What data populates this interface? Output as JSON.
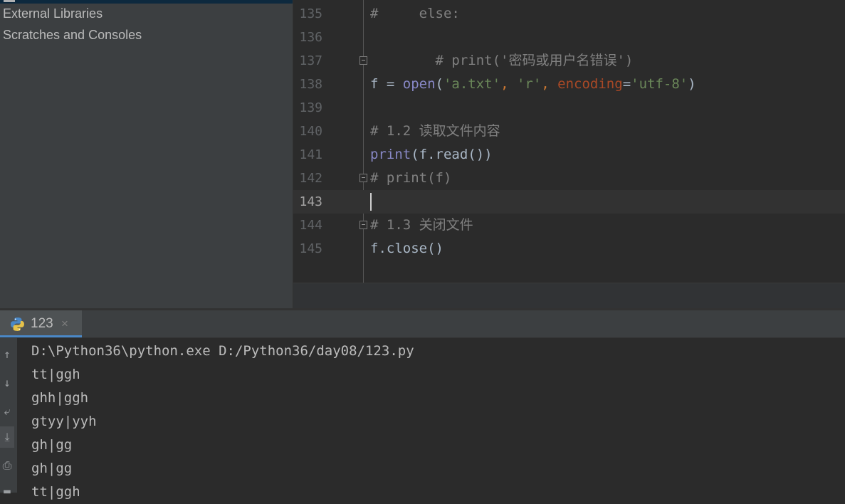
{
  "project_tree": {
    "items": [
      {
        "label": "External Libraries"
      },
      {
        "label": "Scratches and Consoles"
      }
    ]
  },
  "editor": {
    "current_line": "143",
    "lines": [
      {
        "no": "135",
        "spans": [
          {
            "t": "#     else:",
            "c": "comment"
          }
        ]
      },
      {
        "no": "136",
        "spans": []
      },
      {
        "no": "137",
        "fold": true,
        "spans": [
          {
            "t": "        # print('密码或用户名错误')",
            "c": "comment"
          }
        ]
      },
      {
        "no": "138",
        "spans": [
          {
            "t": "f = ",
            "c": "plain"
          },
          {
            "t": "open",
            "c": "builtin"
          },
          {
            "t": "(",
            "c": "plain"
          },
          {
            "t": "'a.txt'",
            "c": "string"
          },
          {
            "t": ", ",
            "c": "kw"
          },
          {
            "t": "'r'",
            "c": "string"
          },
          {
            "t": ", ",
            "c": "kw"
          },
          {
            "t": "encoding",
            "c": "param"
          },
          {
            "t": "=",
            "c": "plain"
          },
          {
            "t": "'utf-8'",
            "c": "string"
          },
          {
            "t": ")",
            "c": "plain"
          }
        ]
      },
      {
        "no": "139",
        "spans": []
      },
      {
        "no": "140",
        "spans": [
          {
            "t": "# 1.2 读取文件内容",
            "c": "comment"
          }
        ]
      },
      {
        "no": "141",
        "spans": [
          {
            "t": "print",
            "c": "builtin"
          },
          {
            "t": "(f.read())",
            "c": "plain"
          }
        ]
      },
      {
        "no": "142",
        "fold": true,
        "spans": [
          {
            "t": "# print(f)",
            "c": "comment"
          }
        ]
      },
      {
        "no": "143",
        "current": true,
        "spans": []
      },
      {
        "no": "144",
        "fold": true,
        "spans": [
          {
            "t": "# 1.3 关闭文件",
            "c": "comment"
          }
        ]
      },
      {
        "no": "145",
        "spans": [
          {
            "t": "f.close()",
            "c": "plain"
          }
        ]
      }
    ]
  },
  "run_panel": {
    "tab_label": "123",
    "close_glyph": "×",
    "toolbar_icons": [
      "arrow-up-icon",
      "arrow-down-icon",
      "soft-wrap-icon",
      "scroll-to-end-icon",
      "print-icon",
      "trash-icon"
    ],
    "toolbar_glyphs": [
      "↑",
      "↓",
      "⤶",
      "⤓",
      "⎙",
      "▬"
    ],
    "console_lines": [
      "D:\\Python36\\python.exe D:/Python36/day08/123.py",
      "tt|ggh",
      "ghh|ggh",
      "gtyy|yyh",
      "gh|gg",
      "gh|gg",
      "tt|ggh"
    ]
  },
  "colors": {
    "comment": "#808080",
    "builtin": "#8888c6",
    "string": "#6a8759",
    "kw": "#cc7832",
    "param": "#aa4926",
    "plain": "#a9b7c6",
    "tab_underline": "#4a88c7"
  }
}
